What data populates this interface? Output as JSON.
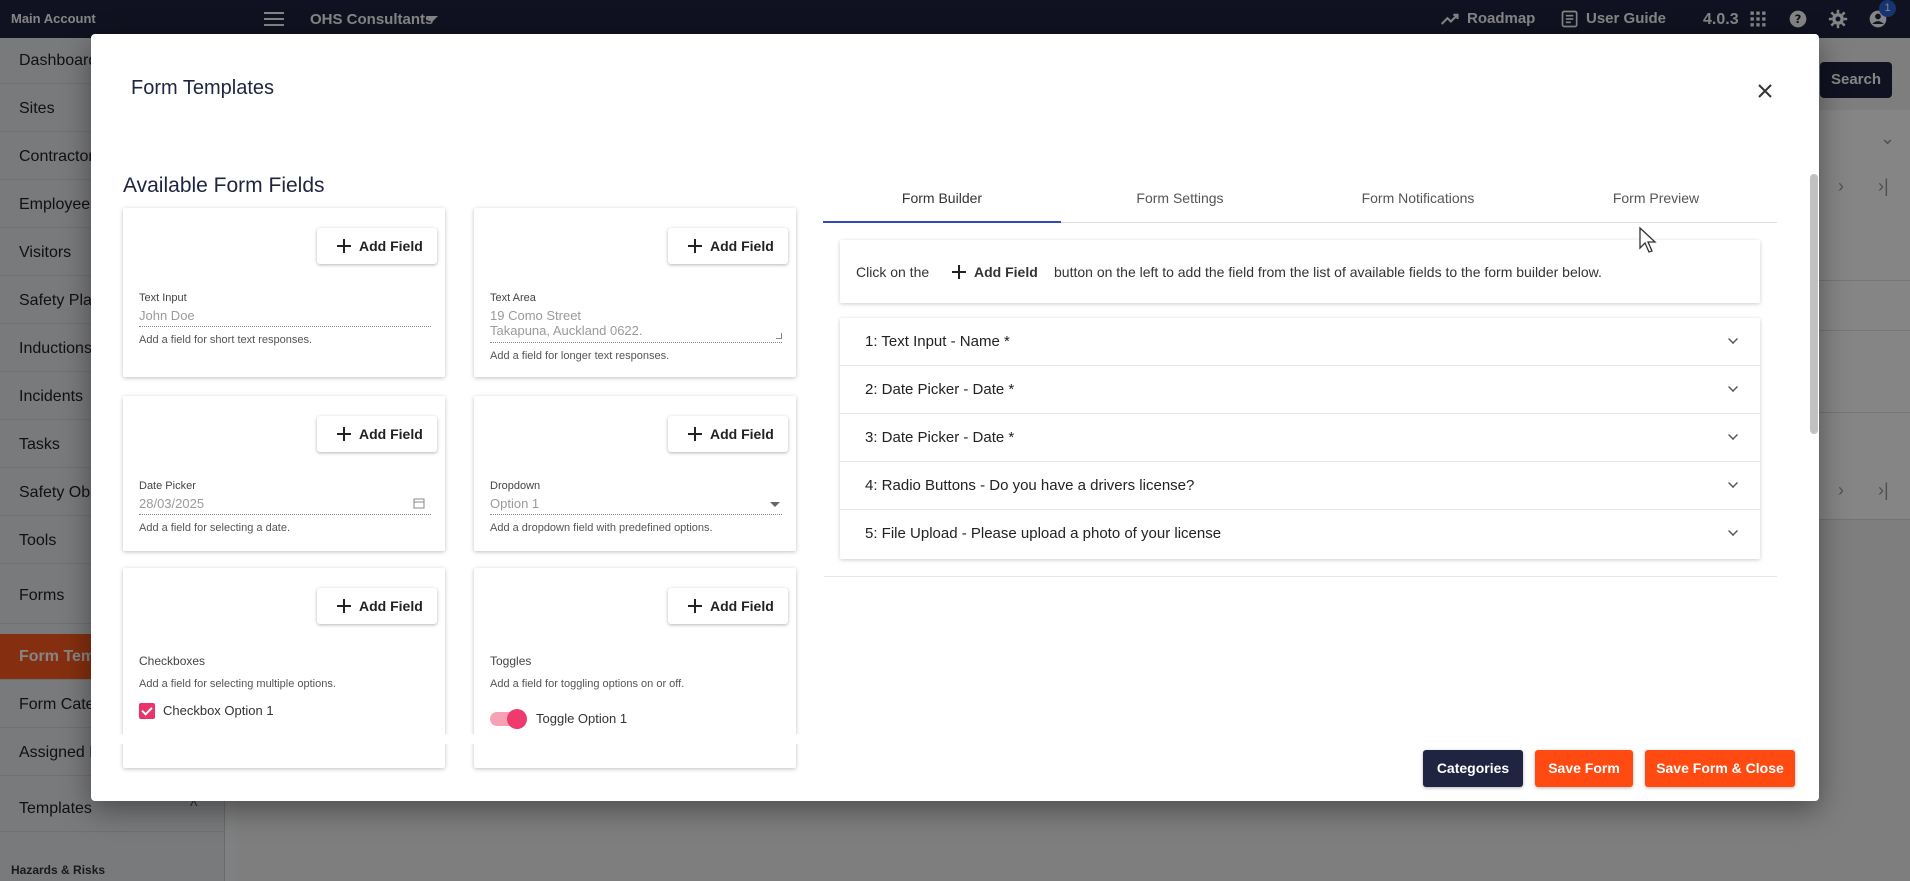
{
  "topbar": {
    "account": "Main Account",
    "organization": "OHS Consultants",
    "roadmap": "Roadmap",
    "user_guide": "User Guide",
    "version": "4.0.3",
    "notification_count": "1",
    "icons": [
      "menu-icon",
      "trending-up-icon",
      "book-icon",
      "apps-grid-icon",
      "help-icon",
      "gear-icon",
      "account-icon"
    ]
  },
  "sidebar": {
    "items": [
      {
        "label": "Dashboard"
      },
      {
        "label": "Sites"
      },
      {
        "label": "Contractors"
      },
      {
        "label": "Employees"
      },
      {
        "label": "Visitors"
      },
      {
        "label": "Safety Plans"
      },
      {
        "label": "Inductions"
      },
      {
        "label": "Incidents"
      },
      {
        "label": "Tasks"
      },
      {
        "label": "Safety Obs"
      },
      {
        "label": "Tools"
      },
      {
        "label": "Forms"
      },
      {
        "label": "Form Temp"
      },
      {
        "label": "Form Categ"
      },
      {
        "label": "Assigned F"
      },
      {
        "label": "Templates"
      }
    ],
    "section_footer": "Hazards & Risks",
    "active_index": 12
  },
  "background": {
    "search_label": "Search"
  },
  "modal": {
    "title": "Form Templates",
    "available_title": "Available Form Fields",
    "add_field_label": "Add Field",
    "fields": [
      {
        "label": "Text Input",
        "value": "John Doe",
        "help": "Add a field for short text responses."
      },
      {
        "label": "Text Area",
        "value_line1": "19 Como Street",
        "value_line2": "Takapuna, Auckland 0622.",
        "help": "Add a field for longer text responses."
      },
      {
        "label": "Date Picker",
        "value": "28/03/2025",
        "help": "Add a field for selecting a date."
      },
      {
        "label": "Dropdown",
        "value": "Option 1",
        "help": "Add a dropdown field with predefined options."
      },
      {
        "label": "Checkboxes",
        "help": "Add a field for selecting multiple options.",
        "option": "Checkbox Option 1",
        "checked": true
      },
      {
        "label": "Toggles",
        "help": "Add a field for toggling options on or off.",
        "option": "Toggle Option 1",
        "on": true
      }
    ],
    "tabs": [
      {
        "label": "Form Builder",
        "active": true
      },
      {
        "label": "Form Settings",
        "active": false
      },
      {
        "label": "Form Notifications",
        "active": false
      },
      {
        "label": "Form Preview",
        "active": false
      }
    ],
    "info": {
      "before": "Click on the",
      "button": "Add Field",
      "after": "button on the left to add the field from the list of available fields to the form builder below."
    },
    "builder_fields": [
      "1: Text Input - Name *",
      "2: Date Picker - Date *",
      "3: Date Picker - Date *",
      "4: Radio Buttons - Do you have a drivers license?",
      "5: File Upload - Please upload a photo of your license"
    ],
    "buttons": {
      "categories": "Categories",
      "save": "Save Form",
      "save_close": "Save Form & Close"
    },
    "colors": {
      "navy": "#1f2440",
      "orange": "#ff4b12",
      "pink": "#e8336b",
      "tab_active": "#2c4bb8"
    }
  }
}
